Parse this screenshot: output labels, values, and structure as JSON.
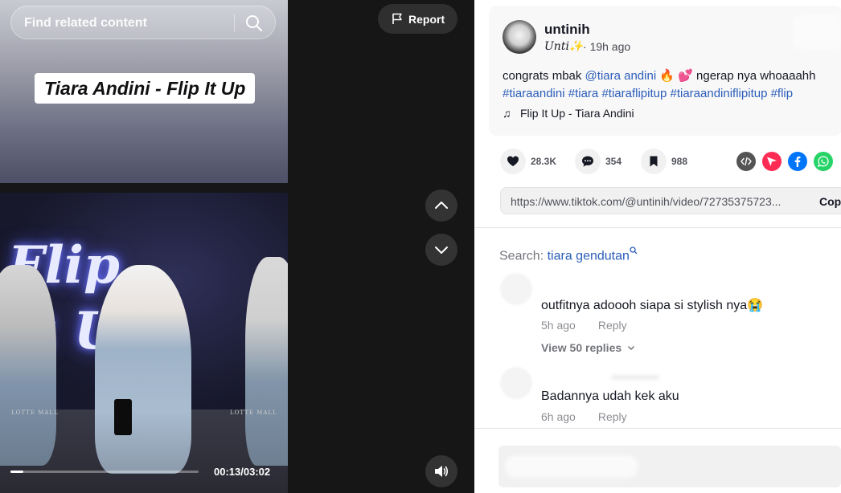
{
  "video": {
    "search_placeholder": "Find related content",
    "title_overlay": "Tiara Andini - Flip It Up",
    "logo_text_line1": "Flip",
    "logo_text_line2": "It Up",
    "venue_text": "LOTTE MALL",
    "report_label": "Report",
    "time": "00:13/03:02",
    "progress": 0.07
  },
  "post": {
    "username": "untinih",
    "nickname": "Unti✨",
    "posted": "19h ago",
    "caption_text": "congrats mbak ",
    "mention": "@tiara andini",
    "caption_emoji": " 🔥 💕 ",
    "caption_tail": "ngerap nya whoaaahh",
    "hashtags": [
      "#tiaraandini",
      "#tiara",
      "#tiaraflipitup",
      "#tiaraandiniflipitup",
      "#flip"
    ],
    "music": "Flip It Up - Tiara Andini"
  },
  "actions": {
    "likes": "28.3K",
    "comments": "354",
    "saves": "988"
  },
  "share": {
    "url": "https://www.tiktok.com/@untinih/video/72735375723...",
    "copy_label": "Copy"
  },
  "search": {
    "label": "Search: ",
    "term": "tiara gendutan"
  },
  "comments": [
    {
      "text": "outfitnya adoooh siapa si stylish nya😭",
      "time": "5h ago",
      "reply": "Reply",
      "view_replies": "View 50 replies"
    },
    {
      "text": "Badannya udah kek aku",
      "time": "6h ago",
      "reply": "Reply"
    }
  ],
  "colors": {
    "link": "#2b5db9",
    "share_embed": "#545454",
    "share_send": "#fe2c55",
    "share_facebook": "#0075fa",
    "share_whatsapp": "#25d366"
  }
}
